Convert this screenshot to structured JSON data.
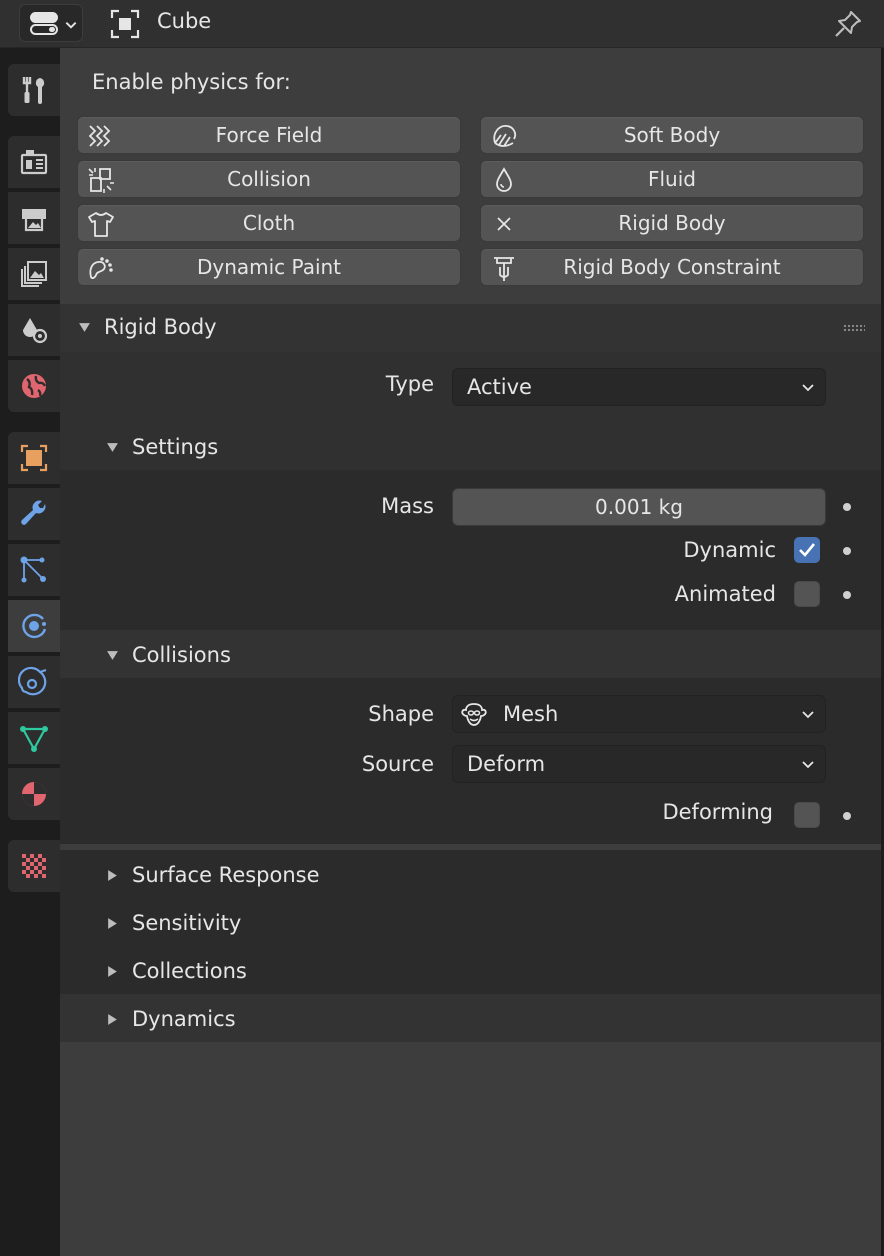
{
  "header": {
    "object_name": "Cube"
  },
  "tabs": [
    {
      "name": "tool",
      "icon": "tool-icon",
      "color": "#cccccc",
      "active": false
    },
    {
      "name": "render",
      "icon": "render-icon",
      "color": "#cccccc",
      "active": false
    },
    {
      "name": "output",
      "icon": "output-icon",
      "color": "#cccccc",
      "active": false
    },
    {
      "name": "view-layer",
      "icon": "view-layer-icon",
      "color": "#cccccc",
      "active": false
    },
    {
      "name": "scene",
      "icon": "scene-icon",
      "color": "#cccccc",
      "active": false
    },
    {
      "name": "world",
      "icon": "world-icon",
      "color": "#e0656f",
      "active": false
    },
    {
      "name": "object",
      "icon": "object-icon",
      "color": "#e8a060",
      "active": false
    },
    {
      "name": "modifiers",
      "icon": "wrench-icon",
      "color": "#6ea3e8",
      "active": false
    },
    {
      "name": "particles",
      "icon": "particles-icon",
      "color": "#6ea3e8",
      "active": false
    },
    {
      "name": "physics",
      "icon": "physics-icon",
      "color": "#6ea3e8",
      "active": true
    },
    {
      "name": "constraints",
      "icon": "constraints-icon",
      "color": "#6ea3e8",
      "active": false
    },
    {
      "name": "data",
      "icon": "mesh-data-icon",
      "color": "#2fc9a0",
      "active": false
    },
    {
      "name": "material",
      "icon": "material-icon",
      "color": "#e0656f",
      "active": false
    },
    {
      "name": "texture",
      "icon": "texture-icon",
      "color": "#e0656f",
      "active": false
    }
  ],
  "physics": {
    "enable_label": "Enable physics for:",
    "buttons": {
      "force_field": "Force Field",
      "soft_body": "Soft Body",
      "collision": "Collision",
      "fluid": "Fluid",
      "cloth": "Cloth",
      "rigid_body": "Rigid Body",
      "dynamic_paint": "Dynamic Paint",
      "rigid_body_constraint": "Rigid Body Constraint"
    }
  },
  "rigid_body": {
    "title": "Rigid Body",
    "type_label": "Type",
    "type_value": "Active",
    "settings": {
      "title": "Settings",
      "mass_label": "Mass",
      "mass_value": "0.001 kg",
      "dynamic_label": "Dynamic",
      "dynamic_checked": true,
      "animated_label": "Animated",
      "animated_checked": false
    },
    "collisions": {
      "title": "Collisions",
      "shape_label": "Shape",
      "shape_value": "Mesh",
      "source_label": "Source",
      "source_value": "Deform",
      "deforming_label": "Deforming",
      "deforming_checked": false
    },
    "subpanels": {
      "surface_response": "Surface Response",
      "sensitivity": "Sensitivity",
      "collections": "Collections",
      "dynamics": "Dynamics"
    }
  }
}
